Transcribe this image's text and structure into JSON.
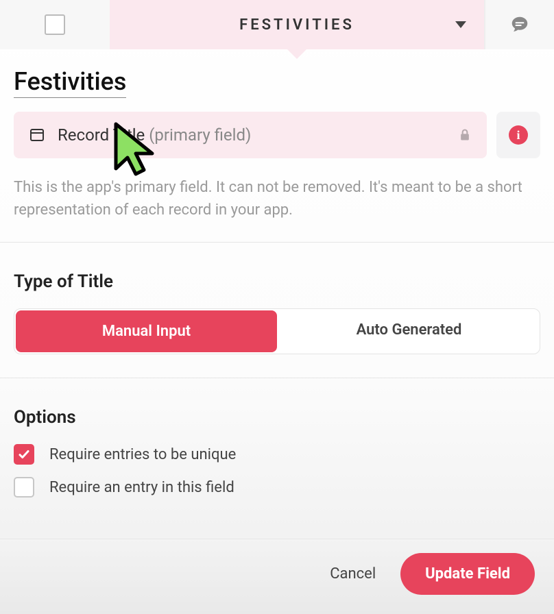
{
  "tabs": {
    "active_label": "FESTIVITIES"
  },
  "title": "Festivities",
  "field": {
    "name": "Record Title",
    "qualifier": "(primary field)"
  },
  "info_glyph": "i",
  "help_text": "This is the app's primary field. It can not be removed. It's meant to be a short representation of each record in your app.",
  "type_section": {
    "heading": "Type of Title",
    "options": {
      "manual": "Manual Input",
      "auto": "Auto Generated"
    },
    "selected": "manual"
  },
  "options_section": {
    "heading": "Options",
    "unique": {
      "label": "Require entries to be unique",
      "checked": true
    },
    "required": {
      "label": "Require an entry in this field",
      "checked": false
    }
  },
  "footer": {
    "cancel": "Cancel",
    "submit": "Update Field"
  },
  "colors": {
    "accent": "#e7445c",
    "tab_bg": "#fbe8ee"
  }
}
